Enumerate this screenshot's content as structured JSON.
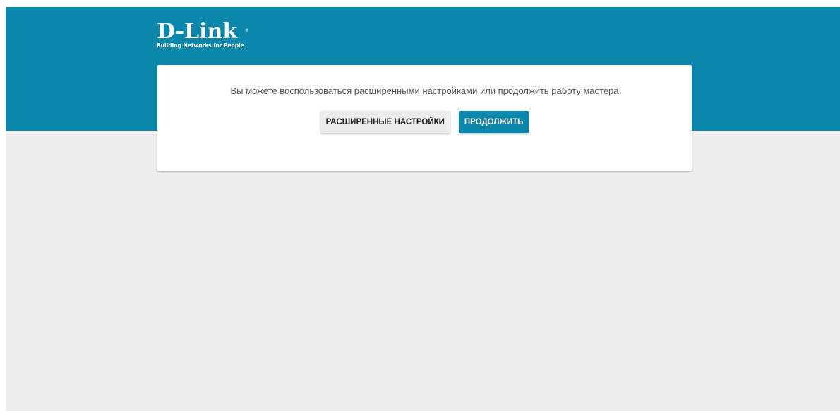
{
  "brand": {
    "name": "D-Link",
    "registered": "®",
    "tagline": "Building Networks for People"
  },
  "dialog": {
    "message": "Вы можете воспользоваться расширенными настройками или продолжить работу мастера",
    "advanced_button": "РАСШИРЕННЫЕ НАСТРОЙКИ",
    "continue_button": "ПРОДОЛЖИТЬ"
  },
  "colors": {
    "header": "#0a87ab",
    "background": "#eeeeee",
    "primary_button": "#0a87ab",
    "card": "#ffffff"
  }
}
